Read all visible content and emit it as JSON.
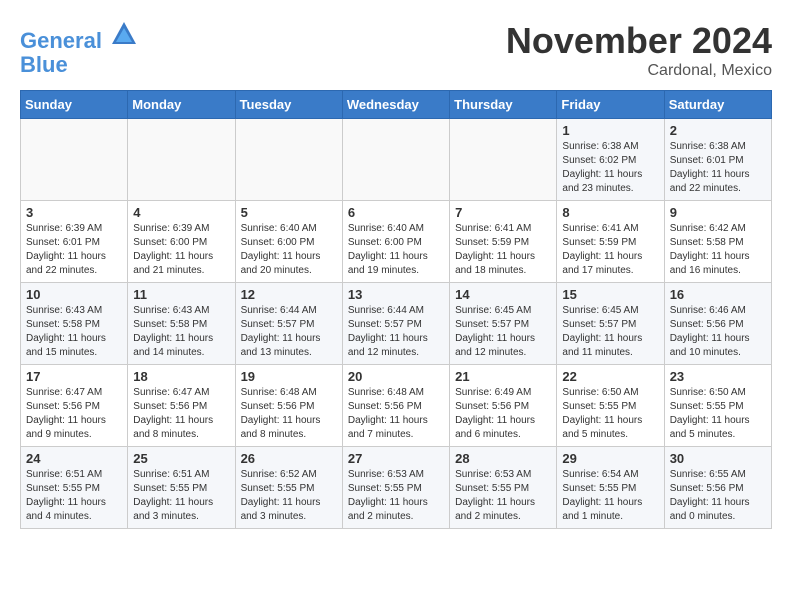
{
  "header": {
    "logo_line1": "General",
    "logo_line2": "Blue",
    "month_title": "November 2024",
    "location": "Cardonal, Mexico"
  },
  "weekdays": [
    "Sunday",
    "Monday",
    "Tuesday",
    "Wednesday",
    "Thursday",
    "Friday",
    "Saturday"
  ],
  "weeks": [
    [
      {
        "day": "",
        "sunrise": "",
        "sunset": "",
        "daylight": ""
      },
      {
        "day": "",
        "sunrise": "",
        "sunset": "",
        "daylight": ""
      },
      {
        "day": "",
        "sunrise": "",
        "sunset": "",
        "daylight": ""
      },
      {
        "day": "",
        "sunrise": "",
        "sunset": "",
        "daylight": ""
      },
      {
        "day": "",
        "sunrise": "",
        "sunset": "",
        "daylight": ""
      },
      {
        "day": "1",
        "sunrise": "Sunrise: 6:38 AM",
        "sunset": "Sunset: 6:02 PM",
        "daylight": "Daylight: 11 hours and 23 minutes."
      },
      {
        "day": "2",
        "sunrise": "Sunrise: 6:38 AM",
        "sunset": "Sunset: 6:01 PM",
        "daylight": "Daylight: 11 hours and 22 minutes."
      }
    ],
    [
      {
        "day": "3",
        "sunrise": "Sunrise: 6:39 AM",
        "sunset": "Sunset: 6:01 PM",
        "daylight": "Daylight: 11 hours and 22 minutes."
      },
      {
        "day": "4",
        "sunrise": "Sunrise: 6:39 AM",
        "sunset": "Sunset: 6:00 PM",
        "daylight": "Daylight: 11 hours and 21 minutes."
      },
      {
        "day": "5",
        "sunrise": "Sunrise: 6:40 AM",
        "sunset": "Sunset: 6:00 PM",
        "daylight": "Daylight: 11 hours and 20 minutes."
      },
      {
        "day": "6",
        "sunrise": "Sunrise: 6:40 AM",
        "sunset": "Sunset: 6:00 PM",
        "daylight": "Daylight: 11 hours and 19 minutes."
      },
      {
        "day": "7",
        "sunrise": "Sunrise: 6:41 AM",
        "sunset": "Sunset: 5:59 PM",
        "daylight": "Daylight: 11 hours and 18 minutes."
      },
      {
        "day": "8",
        "sunrise": "Sunrise: 6:41 AM",
        "sunset": "Sunset: 5:59 PM",
        "daylight": "Daylight: 11 hours and 17 minutes."
      },
      {
        "day": "9",
        "sunrise": "Sunrise: 6:42 AM",
        "sunset": "Sunset: 5:58 PM",
        "daylight": "Daylight: 11 hours and 16 minutes."
      }
    ],
    [
      {
        "day": "10",
        "sunrise": "Sunrise: 6:43 AM",
        "sunset": "Sunset: 5:58 PM",
        "daylight": "Daylight: 11 hours and 15 minutes."
      },
      {
        "day": "11",
        "sunrise": "Sunrise: 6:43 AM",
        "sunset": "Sunset: 5:58 PM",
        "daylight": "Daylight: 11 hours and 14 minutes."
      },
      {
        "day": "12",
        "sunrise": "Sunrise: 6:44 AM",
        "sunset": "Sunset: 5:57 PM",
        "daylight": "Daylight: 11 hours and 13 minutes."
      },
      {
        "day": "13",
        "sunrise": "Sunrise: 6:44 AM",
        "sunset": "Sunset: 5:57 PM",
        "daylight": "Daylight: 11 hours and 12 minutes."
      },
      {
        "day": "14",
        "sunrise": "Sunrise: 6:45 AM",
        "sunset": "Sunset: 5:57 PM",
        "daylight": "Daylight: 11 hours and 12 minutes."
      },
      {
        "day": "15",
        "sunrise": "Sunrise: 6:45 AM",
        "sunset": "Sunset: 5:57 PM",
        "daylight": "Daylight: 11 hours and 11 minutes."
      },
      {
        "day": "16",
        "sunrise": "Sunrise: 6:46 AM",
        "sunset": "Sunset: 5:56 PM",
        "daylight": "Daylight: 11 hours and 10 minutes."
      }
    ],
    [
      {
        "day": "17",
        "sunrise": "Sunrise: 6:47 AM",
        "sunset": "Sunset: 5:56 PM",
        "daylight": "Daylight: 11 hours and 9 minutes."
      },
      {
        "day": "18",
        "sunrise": "Sunrise: 6:47 AM",
        "sunset": "Sunset: 5:56 PM",
        "daylight": "Daylight: 11 hours and 8 minutes."
      },
      {
        "day": "19",
        "sunrise": "Sunrise: 6:48 AM",
        "sunset": "Sunset: 5:56 PM",
        "daylight": "Daylight: 11 hours and 8 minutes."
      },
      {
        "day": "20",
        "sunrise": "Sunrise: 6:48 AM",
        "sunset": "Sunset: 5:56 PM",
        "daylight": "Daylight: 11 hours and 7 minutes."
      },
      {
        "day": "21",
        "sunrise": "Sunrise: 6:49 AM",
        "sunset": "Sunset: 5:56 PM",
        "daylight": "Daylight: 11 hours and 6 minutes."
      },
      {
        "day": "22",
        "sunrise": "Sunrise: 6:50 AM",
        "sunset": "Sunset: 5:55 PM",
        "daylight": "Daylight: 11 hours and 5 minutes."
      },
      {
        "day": "23",
        "sunrise": "Sunrise: 6:50 AM",
        "sunset": "Sunset: 5:55 PM",
        "daylight": "Daylight: 11 hours and 5 minutes."
      }
    ],
    [
      {
        "day": "24",
        "sunrise": "Sunrise: 6:51 AM",
        "sunset": "Sunset: 5:55 PM",
        "daylight": "Daylight: 11 hours and 4 minutes."
      },
      {
        "day": "25",
        "sunrise": "Sunrise: 6:51 AM",
        "sunset": "Sunset: 5:55 PM",
        "daylight": "Daylight: 11 hours and 3 minutes."
      },
      {
        "day": "26",
        "sunrise": "Sunrise: 6:52 AM",
        "sunset": "Sunset: 5:55 PM",
        "daylight": "Daylight: 11 hours and 3 minutes."
      },
      {
        "day": "27",
        "sunrise": "Sunrise: 6:53 AM",
        "sunset": "Sunset: 5:55 PM",
        "daylight": "Daylight: 11 hours and 2 minutes."
      },
      {
        "day": "28",
        "sunrise": "Sunrise: 6:53 AM",
        "sunset": "Sunset: 5:55 PM",
        "daylight": "Daylight: 11 hours and 2 minutes."
      },
      {
        "day": "29",
        "sunrise": "Sunrise: 6:54 AM",
        "sunset": "Sunset: 5:55 PM",
        "daylight": "Daylight: 11 hours and 1 minute."
      },
      {
        "day": "30",
        "sunrise": "Sunrise: 6:55 AM",
        "sunset": "Sunset: 5:56 PM",
        "daylight": "Daylight: 11 hours and 0 minutes."
      }
    ]
  ]
}
